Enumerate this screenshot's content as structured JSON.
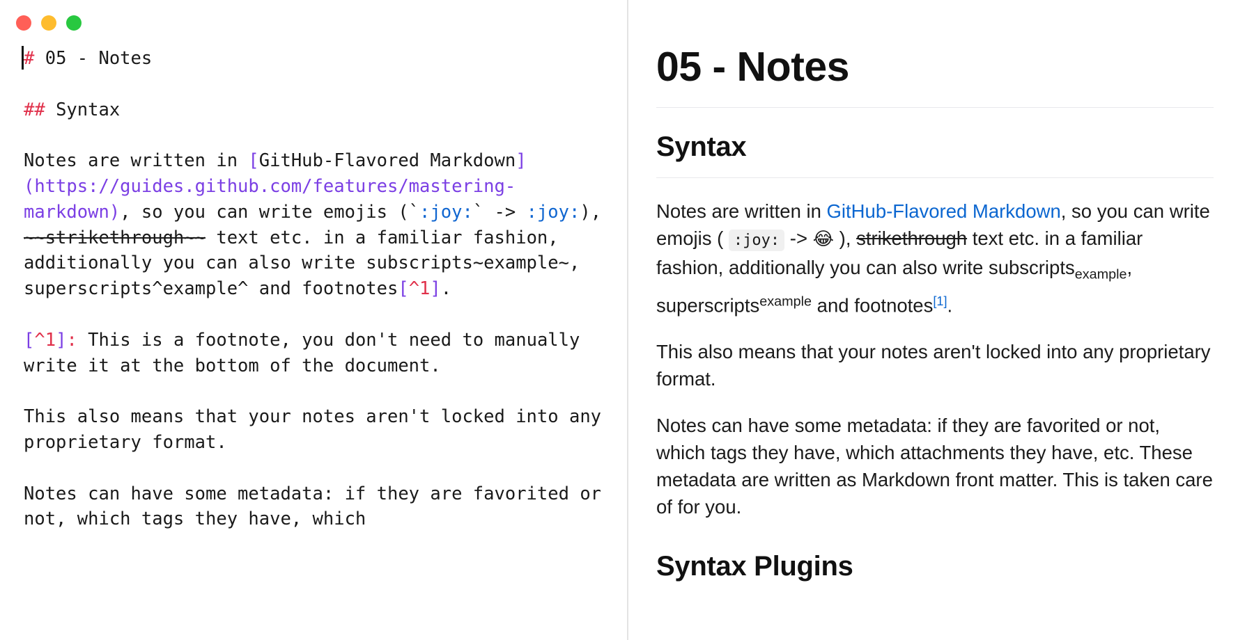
{
  "window": {
    "traffic_lights": [
      {
        "name": "close",
        "color": "#FF5F57"
      },
      {
        "name": "minimize",
        "color": "#FEBC2E"
      },
      {
        "name": "maximize",
        "color": "#28C840"
      }
    ]
  },
  "editor": {
    "caret_visible": true,
    "lines": {
      "h1_hash": "#",
      "h1_text": " 05 - Notes",
      "h2_hash": "##",
      "h2_text": " Syntax",
      "p1_a": "Notes are written in ",
      "p1_lb": "[",
      "p1_link_label": "GitHub-Flavored Markdown",
      "p1_rb": "]",
      "p1_url": "(https://guides.github.com/features/mastering-markdown)",
      "p1_b": ", so you can write emojis (`",
      "p1_joy1": ":joy:",
      "p1_c": "` -> ",
      "p1_joy2": ":joy:",
      "p1_d": "), ",
      "p1_strike": "~~strikethrough~~",
      "p1_e": " text etc. in a familiar fashion, additionally you can also write subscripts~example~, superscripts^example^ and footnotes",
      "p1_fn_lb": "[",
      "p1_fn_num": "^1",
      "p1_fn_rb": "]",
      "p1_f": ".",
      "fndef_lb": "[",
      "fndef_num": "^1",
      "fndef_rb": "]",
      "fndef_colon": ":",
      "fndef_text": " This is a footnote, you don't need to manually write it at the bottom of the document.",
      "p2": "This also means that your notes aren't locked into any proprietary format.",
      "p3": "Notes can have some metadata: if they are favorited or not, which tags they have, which"
    }
  },
  "preview": {
    "h1": "05 - Notes",
    "h2_syntax": "Syntax",
    "p1": {
      "a": "Notes are written in ",
      "link": "GitHub-Flavored Markdown",
      "b": ", so you can write emojis ( ",
      "code": ":joy:",
      "c": " -> ",
      "emoji": "😂",
      "d": " ), ",
      "strike": "strikethrough",
      "e": " text etc. in a familiar fashion, additionally you can also write sub­scripts",
      "sub": "example",
      "f": ", superscripts",
      "sup": "example",
      "g": " and footnotes",
      "fnref": "[1]",
      "h": "."
    },
    "p2": "This also means that your notes aren't locked into any proprietary format.",
    "p3": "Notes can have some metadata: if they are favorited or not, which tags they have, which attachments they have, etc. These metadata are written as Markdown front matter. This is taken care of for you.",
    "h2_plugins": "Syntax Plugins"
  },
  "colors": {
    "link": "#0b66d0",
    "heading_marker": "#e0304a",
    "markdown_syntax": "#7b3fe4",
    "emoji_code": "#1066d0",
    "divider": "#e3e3e3"
  }
}
